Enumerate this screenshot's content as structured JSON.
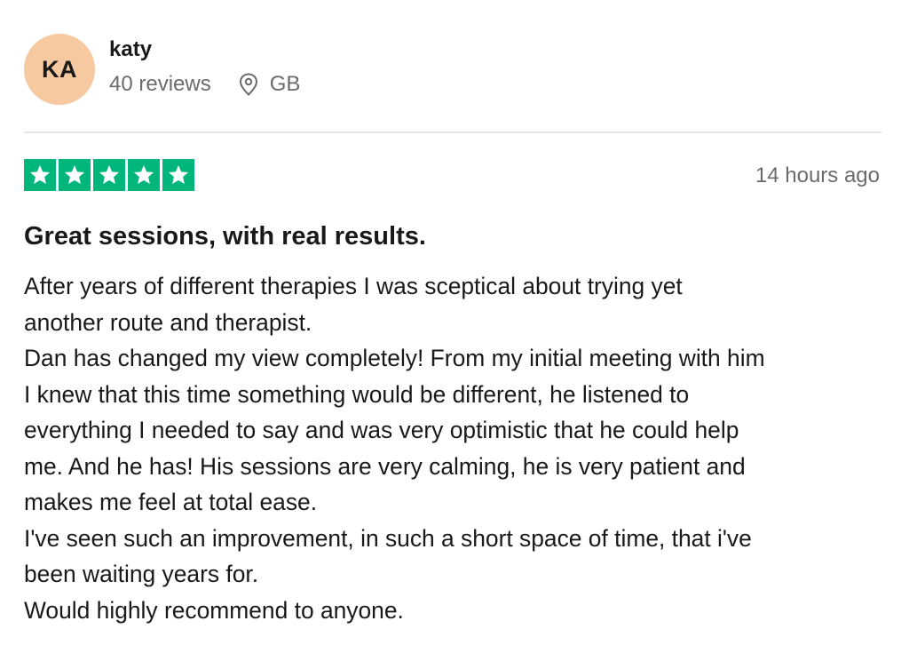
{
  "reviewer": {
    "initials": "KA",
    "name": "katy",
    "review_count": "40 reviews",
    "location": "GB",
    "avatar_color": "#f6c9a0"
  },
  "rating": {
    "stars": 5,
    "max_stars": 5,
    "star_color": "#00b67a",
    "icon": "star-icon"
  },
  "review": {
    "timestamp": "14 hours ago",
    "title": "Great sessions, with real results.",
    "lines": [
      "After years of different therapies I was sceptical about trying yet",
      "another route and therapist.",
      "Dan has changed my view completely! From my initial meeting with him",
      "I knew that this time something would be different, he listened to",
      "everything I needed to say and was very optimistic that he could help",
      "me. And he has! His sessions are very calming, he is very patient and",
      "makes me feel at total ease.",
      "I've seen such an improvement, in such a short space of time, that i've",
      "been waiting years for.",
      "Would highly recommend to anyone."
    ]
  },
  "icons": {
    "location": "map-pin-icon"
  }
}
